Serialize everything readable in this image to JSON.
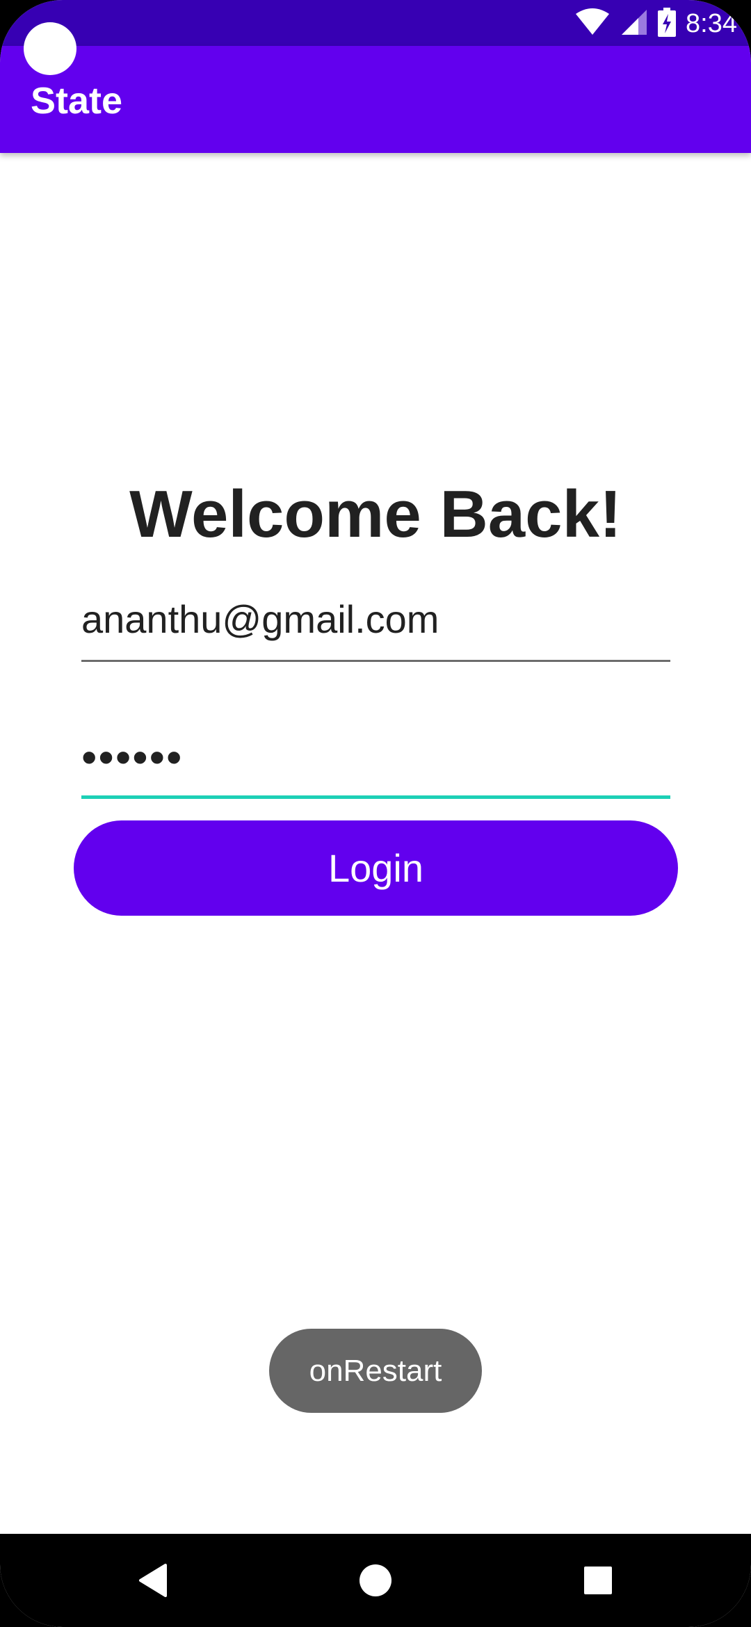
{
  "status_bar": {
    "time": "8:34",
    "icons": [
      "wifi-icon",
      "signal-icon",
      "battery-charging-icon"
    ]
  },
  "app_bar": {
    "title": "State"
  },
  "main": {
    "heading": "Welcome Back!",
    "email_value": "ananthu@gmail.com",
    "password_masked": "••••••",
    "login_label": "Login"
  },
  "toast": {
    "message": "onRestart"
  },
  "colors": {
    "status_bar": "#3700b3",
    "primary": "#6200ee",
    "focused_underline": "#1dd0b6",
    "toast_bg": "#666666"
  },
  "nav_bar": {
    "buttons": [
      "back-icon",
      "home-icon",
      "recents-icon"
    ]
  }
}
